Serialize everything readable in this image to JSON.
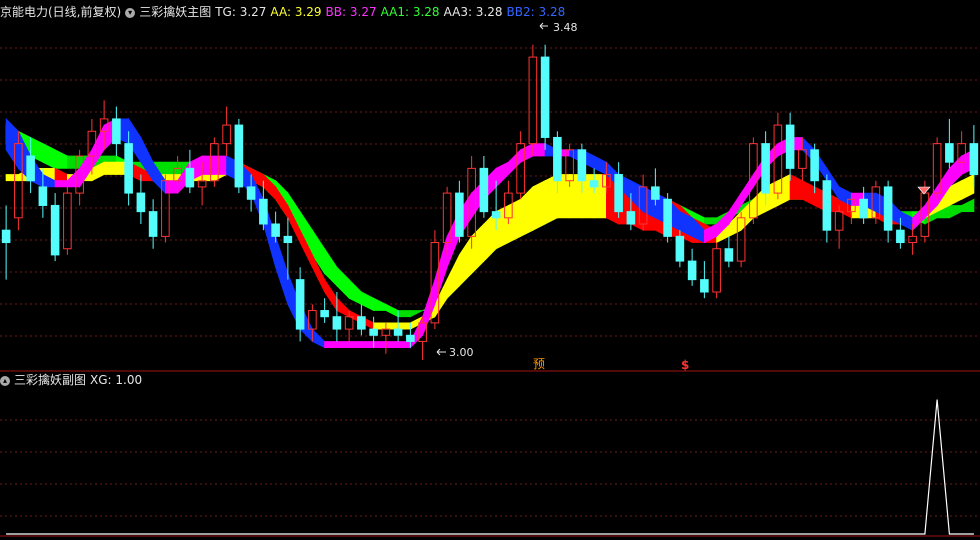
{
  "header": {
    "stock_name": "京能电力(日线,前复权)",
    "main_indicator": "三彩擒妖主图",
    "indicators": [
      {
        "label": "TG: 3.27",
        "color": "#e6e6e6"
      },
      {
        "label": "AA: 3.29",
        "color": "#ffff33"
      },
      {
        "label": "BB: 3.27",
        "color": "#ff33ff"
      },
      {
        "label": "AA1: 3.28",
        "color": "#33ff33"
      },
      {
        "label": "AA3: 3.28",
        "color": "#e6e6e6"
      },
      {
        "label": "BB2: 3.28",
        "color": "#3366ff"
      }
    ],
    "dropdown_icon": "chevron-down-icon"
  },
  "sub_header": {
    "indicator": "三彩擒妖副图",
    "value": "XG: 1.00",
    "collapse_icon": "chevron-up-icon"
  },
  "annotations": {
    "high_label": "3.48",
    "low_label": "3.00",
    "yu_mark": "预",
    "dollar_mark": "$"
  },
  "colors": {
    "up": "#ff3333",
    "down": "#54fcfc",
    "grid": "#6e1b1b",
    "band_red": "#ff0000",
    "band_yellow": "#ffff00",
    "band_magenta": "#ff00ff",
    "band_blue": "#1133ff",
    "band_green": "#00ff00"
  },
  "chart_data": [
    {
      "type": "candlestick",
      "ylim": [
        2.97,
        3.52
      ],
      "candles": [
        [
          3.18,
          3.22,
          3.1,
          3.16
        ],
        [
          3.2,
          3.34,
          3.18,
          3.32
        ],
        [
          3.3,
          3.33,
          3.24,
          3.26
        ],
        [
          3.25,
          3.28,
          3.2,
          3.22
        ],
        [
          3.22,
          3.24,
          3.13,
          3.14
        ],
        [
          3.15,
          3.25,
          3.14,
          3.24
        ],
        [
          3.24,
          3.31,
          3.22,
          3.3
        ],
        [
          3.3,
          3.36,
          3.27,
          3.34
        ],
        [
          3.34,
          3.39,
          3.31,
          3.36
        ],
        [
          3.36,
          3.38,
          3.3,
          3.32
        ],
        [
          3.32,
          3.34,
          3.22,
          3.24
        ],
        [
          3.24,
          3.27,
          3.19,
          3.21
        ],
        [
          3.21,
          3.23,
          3.15,
          3.17
        ],
        [
          3.17,
          3.27,
          3.16,
          3.26
        ],
        [
          3.26,
          3.3,
          3.24,
          3.28
        ],
        [
          3.28,
          3.31,
          3.24,
          3.25
        ],
        [
          3.25,
          3.29,
          3.22,
          3.26
        ],
        [
          3.26,
          3.33,
          3.25,
          3.32
        ],
        [
          3.32,
          3.38,
          3.3,
          3.35
        ],
        [
          3.35,
          3.36,
          3.24,
          3.25
        ],
        [
          3.25,
          3.27,
          3.21,
          3.23
        ],
        [
          3.23,
          3.26,
          3.18,
          3.19
        ],
        [
          3.19,
          3.21,
          3.16,
          3.17
        ],
        [
          3.17,
          3.2,
          3.1,
          3.16
        ],
        [
          3.1,
          3.12,
          3.0,
          3.02
        ],
        [
          3.02,
          3.06,
          3.0,
          3.05
        ],
        [
          3.05,
          3.07,
          3.03,
          3.04
        ],
        [
          3.04,
          3.08,
          3.0,
          3.02
        ],
        [
          3.02,
          3.05,
          3.0,
          3.04
        ],
        [
          3.04,
          3.06,
          3.01,
          3.02
        ],
        [
          3.02,
          3.04,
          2.99,
          3.01
        ],
        [
          3.01,
          3.03,
          2.98,
          3.02
        ],
        [
          3.02,
          3.05,
          3.0,
          3.01
        ],
        [
          3.01,
          3.03,
          2.99,
          3.0
        ],
        [
          3.0,
          3.04,
          2.97,
          3.03
        ],
        [
          3.03,
          3.18,
          3.02,
          3.16
        ],
        [
          3.16,
          3.25,
          3.14,
          3.24
        ],
        [
          3.24,
          3.26,
          3.16,
          3.17
        ],
        [
          3.17,
          3.3,
          3.15,
          3.28
        ],
        [
          3.28,
          3.3,
          3.2,
          3.21
        ],
        [
          3.21,
          3.26,
          3.18,
          3.2
        ],
        [
          3.2,
          3.26,
          3.19,
          3.24
        ],
        [
          3.24,
          3.34,
          3.23,
          3.32
        ],
        [
          3.32,
          3.48,
          3.3,
          3.46
        ],
        [
          3.46,
          3.48,
          3.31,
          3.33
        ],
        [
          3.33,
          3.34,
          3.24,
          3.26
        ],
        [
          3.26,
          3.32,
          3.25,
          3.31
        ],
        [
          3.31,
          3.32,
          3.24,
          3.26
        ],
        [
          3.26,
          3.28,
          3.24,
          3.25
        ],
        [
          3.25,
          3.29,
          3.24,
          3.27
        ],
        [
          3.27,
          3.29,
          3.2,
          3.21
        ],
        [
          3.21,
          3.24,
          3.18,
          3.19
        ],
        [
          3.19,
          3.27,
          3.18,
          3.25
        ],
        [
          3.25,
          3.28,
          3.22,
          3.23
        ],
        [
          3.23,
          3.24,
          3.16,
          3.17
        ],
        [
          3.17,
          3.18,
          3.12,
          3.13
        ],
        [
          3.13,
          3.15,
          3.09,
          3.1
        ],
        [
          3.1,
          3.13,
          3.07,
          3.08
        ],
        [
          3.08,
          3.16,
          3.07,
          3.15
        ],
        [
          3.15,
          3.17,
          3.12,
          3.13
        ],
        [
          3.13,
          3.21,
          3.12,
          3.2
        ],
        [
          3.2,
          3.33,
          3.19,
          3.32
        ],
        [
          3.32,
          3.34,
          3.22,
          3.24
        ],
        [
          3.24,
          3.37,
          3.23,
          3.35
        ],
        [
          3.35,
          3.37,
          3.26,
          3.28
        ],
        [
          3.28,
          3.33,
          3.26,
          3.31
        ],
        [
          3.31,
          3.32,
          3.24,
          3.26
        ],
        [
          3.26,
          3.27,
          3.16,
          3.18
        ],
        [
          3.18,
          3.22,
          3.15,
          3.21
        ],
        [
          3.21,
          3.24,
          3.19,
          3.23
        ],
        [
          3.23,
          3.25,
          3.19,
          3.2
        ],
        [
          3.2,
          3.26,
          3.19,
          3.25
        ],
        [
          3.25,
          3.26,
          3.16,
          3.18
        ],
        [
          3.18,
          3.2,
          3.15,
          3.16
        ],
        [
          3.16,
          3.19,
          3.14,
          3.17
        ],
        [
          3.17,
          3.26,
          3.16,
          3.24
        ],
        [
          3.24,
          3.33,
          3.23,
          3.32
        ],
        [
          3.32,
          3.36,
          3.28,
          3.29
        ],
        [
          3.29,
          3.34,
          3.27,
          3.32
        ],
        [
          3.32,
          3.35,
          3.25,
          3.27
        ]
      ],
      "bands": [
        {
          "name": "",
          "colors": [
            "#00ff00",
            "#00dd00"
          ],
          "upper": [
            3.35,
            3.34,
            3.33,
            3.32,
            3.31,
            3.3,
            3.3,
            3.3,
            3.3,
            3.3,
            3.29,
            3.29,
            3.29,
            3.29,
            3.29,
            3.29,
            3.29,
            3.29,
            3.29,
            3.29,
            3.28,
            3.27,
            3.26,
            3.24,
            3.21,
            3.18,
            3.15,
            3.12,
            3.1,
            3.08,
            3.07,
            3.06,
            3.05,
            3.05,
            3.05,
            3.06,
            3.08,
            3.1,
            3.13,
            3.15,
            3.17,
            3.18,
            3.19,
            3.2,
            3.21,
            3.22,
            3.22,
            3.23,
            3.24,
            3.24,
            3.24,
            3.24,
            3.24,
            3.23,
            3.23,
            3.22,
            3.21,
            3.2,
            3.2,
            3.21,
            3.22,
            3.23,
            3.24,
            3.25,
            3.25,
            3.25,
            3.24,
            3.24,
            3.23,
            3.23,
            3.22,
            3.22,
            3.22,
            3.21,
            3.21,
            3.21,
            3.21,
            3.22,
            3.22,
            3.23
          ],
          "lower": [
            3.32,
            3.31,
            3.3,
            3.29,
            3.28,
            3.28,
            3.28,
            3.28,
            3.28,
            3.28,
            3.27,
            3.27,
            3.27,
            3.27,
            3.27,
            3.27,
            3.27,
            3.27,
            3.27,
            3.27,
            3.26,
            3.25,
            3.23,
            3.2,
            3.17,
            3.14,
            3.11,
            3.09,
            3.07,
            3.06,
            3.05,
            3.05,
            3.04,
            3.04,
            3.05,
            3.05,
            3.07,
            3.09,
            3.11,
            3.13,
            3.15,
            3.16,
            3.17,
            3.18,
            3.19,
            3.2,
            3.21,
            3.21,
            3.22,
            3.22,
            3.22,
            3.22,
            3.22,
            3.22,
            3.21,
            3.2,
            3.19,
            3.19,
            3.19,
            3.2,
            3.21,
            3.22,
            3.22,
            3.23,
            3.23,
            3.23,
            3.23,
            3.22,
            3.22,
            3.21,
            3.21,
            3.2,
            3.2,
            3.2,
            3.2,
            3.19,
            3.2,
            3.2,
            3.21,
            3.21
          ]
        },
        {
          "name": "",
          "colors": [
            "#ff0000",
            "#ffff00"
          ],
          "upper": [
            3.27,
            3.27,
            3.28,
            3.28,
            3.28,
            3.27,
            3.27,
            3.28,
            3.29,
            3.29,
            3.29,
            3.28,
            3.27,
            3.27,
            3.27,
            3.27,
            3.27,
            3.28,
            3.29,
            3.29,
            3.28,
            3.27,
            3.25,
            3.22,
            3.18,
            3.14,
            3.1,
            3.07,
            3.05,
            3.04,
            3.03,
            3.03,
            3.03,
            3.03,
            3.04,
            3.06,
            3.1,
            3.14,
            3.17,
            3.19,
            3.21,
            3.22,
            3.23,
            3.25,
            3.26,
            3.27,
            3.27,
            3.27,
            3.27,
            3.27,
            3.26,
            3.25,
            3.25,
            3.24,
            3.23,
            3.22,
            3.2,
            3.19,
            3.18,
            3.19,
            3.21,
            3.23,
            3.25,
            3.26,
            3.27,
            3.26,
            3.25,
            3.24,
            3.23,
            3.22,
            3.22,
            3.22,
            3.21,
            3.2,
            3.2,
            3.21,
            3.23,
            3.25,
            3.26,
            3.27
          ],
          "lower": [
            3.26,
            3.26,
            3.26,
            3.26,
            3.26,
            3.26,
            3.26,
            3.26,
            3.27,
            3.27,
            3.27,
            3.26,
            3.26,
            3.26,
            3.26,
            3.26,
            3.26,
            3.26,
            3.27,
            3.27,
            3.26,
            3.25,
            3.23,
            3.2,
            3.16,
            3.12,
            3.08,
            3.05,
            3.04,
            3.03,
            3.02,
            3.02,
            3.02,
            3.02,
            3.03,
            3.04,
            3.07,
            3.09,
            3.11,
            3.13,
            3.15,
            3.16,
            3.17,
            3.18,
            3.19,
            3.2,
            3.2,
            3.2,
            3.2,
            3.2,
            3.19,
            3.19,
            3.18,
            3.18,
            3.17,
            3.17,
            3.16,
            3.16,
            3.16,
            3.17,
            3.18,
            3.2,
            3.21,
            3.22,
            3.23,
            3.23,
            3.22,
            3.21,
            3.21,
            3.2,
            3.2,
            3.2,
            3.19,
            3.19,
            3.19,
            3.2,
            3.21,
            3.22,
            3.23,
            3.24
          ]
        },
        {
          "name": "",
          "colors": [
            "#1133ff",
            "#ff00ff"
          ],
          "upper": [
            3.36,
            3.34,
            3.3,
            3.27,
            3.26,
            3.26,
            3.28,
            3.31,
            3.35,
            3.36,
            3.36,
            3.33,
            3.29,
            3.26,
            3.26,
            3.29,
            3.3,
            3.3,
            3.3,
            3.29,
            3.27,
            3.23,
            3.17,
            3.11,
            3.06,
            3.02,
            3.0,
            3.0,
            3.0,
            3.0,
            3.0,
            3.0,
            3.0,
            3.0,
            3.04,
            3.1,
            3.17,
            3.21,
            3.24,
            3.26,
            3.28,
            3.29,
            3.31,
            3.32,
            3.32,
            3.31,
            3.31,
            3.31,
            3.3,
            3.29,
            3.27,
            3.26,
            3.25,
            3.24,
            3.23,
            3.21,
            3.2,
            3.18,
            3.19,
            3.21,
            3.24,
            3.27,
            3.3,
            3.32,
            3.33,
            3.33,
            3.31,
            3.28,
            3.25,
            3.24,
            3.24,
            3.24,
            3.23,
            3.21,
            3.2,
            3.22,
            3.25,
            3.28,
            3.3,
            3.31
          ],
          "lower": [
            3.31,
            3.28,
            3.26,
            3.25,
            3.25,
            3.25,
            3.25,
            3.28,
            3.31,
            3.33,
            3.32,
            3.29,
            3.26,
            3.24,
            3.24,
            3.26,
            3.27,
            3.27,
            3.27,
            3.26,
            3.24,
            3.19,
            3.12,
            3.06,
            3.02,
            3.0,
            2.99,
            2.99,
            2.99,
            2.99,
            2.99,
            2.99,
            2.99,
            2.99,
            3.01,
            3.06,
            3.12,
            3.17,
            3.2,
            3.23,
            3.25,
            3.27,
            3.29,
            3.3,
            3.3,
            3.3,
            3.3,
            3.29,
            3.28,
            3.27,
            3.25,
            3.23,
            3.21,
            3.2,
            3.19,
            3.18,
            3.17,
            3.16,
            3.17,
            3.19,
            3.22,
            3.25,
            3.28,
            3.3,
            3.31,
            3.31,
            3.29,
            3.26,
            3.23,
            3.22,
            3.22,
            3.21,
            3.2,
            3.19,
            3.18,
            3.2,
            3.22,
            3.25,
            3.27,
            3.28
          ]
        }
      ]
    },
    {
      "type": "line",
      "name": "XG",
      "ylim": [
        0,
        1.1
      ],
      "values": [
        0,
        0,
        0,
        0,
        0,
        0,
        0,
        0,
        0,
        0,
        0,
        0,
        0,
        0,
        0,
        0,
        0,
        0,
        0,
        0,
        0,
        0,
        0,
        0,
        0,
        0,
        0,
        0,
        0,
        0,
        0,
        0,
        0,
        0,
        0,
        0,
        0,
        0,
        0,
        0,
        0,
        0,
        0,
        0,
        0,
        0,
        0,
        0,
        0,
        0,
        0,
        0,
        0,
        0,
        0,
        0,
        0,
        0,
        0,
        0,
        0,
        0,
        0,
        0,
        0,
        0,
        0,
        0,
        0,
        0,
        0,
        0,
        0,
        0,
        0,
        0,
        1,
        0,
        0,
        0
      ]
    }
  ]
}
